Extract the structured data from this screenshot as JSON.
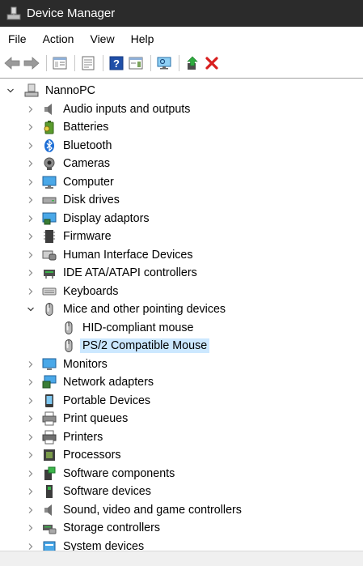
{
  "window": {
    "title": "Device Manager"
  },
  "menu": [
    "File",
    "Action",
    "View",
    "Help"
  ],
  "colors": {
    "titlebar": "#2b2b2b",
    "selection": "#cce8ff",
    "accent": "#0078d7"
  },
  "tree": {
    "root": "NannoPC",
    "categories": [
      {
        "label": "Audio inputs and outputs",
        "icon": "speaker-icon"
      },
      {
        "label": "Batteries",
        "icon": "battery-icon"
      },
      {
        "label": "Bluetooth",
        "icon": "bluetooth-icon"
      },
      {
        "label": "Cameras",
        "icon": "camera-icon"
      },
      {
        "label": "Computer",
        "icon": "computer-icon"
      },
      {
        "label": "Disk drives",
        "icon": "disk-drive-icon"
      },
      {
        "label": "Display adaptors",
        "icon": "display-adapter-icon"
      },
      {
        "label": "Firmware",
        "icon": "firmware-icon"
      },
      {
        "label": "Human Interface Devices",
        "icon": "hid-icon"
      },
      {
        "label": "IDE ATA/ATAPI controllers",
        "icon": "ide-controller-icon"
      },
      {
        "label": "Keyboards",
        "icon": "keyboard-icon"
      },
      {
        "label": "Mice and other pointing devices",
        "icon": "mouse-icon",
        "expanded": true,
        "children": [
          {
            "label": "HID-compliant mouse",
            "icon": "mouse-icon"
          },
          {
            "label": "PS/2 Compatible Mouse",
            "icon": "mouse-icon",
            "selected": true
          }
        ]
      },
      {
        "label": "Monitors",
        "icon": "monitor-icon"
      },
      {
        "label": "Network adapters",
        "icon": "network-adapter-icon"
      },
      {
        "label": "Portable Devices",
        "icon": "portable-device-icon"
      },
      {
        "label": "Print queues",
        "icon": "print-queue-icon"
      },
      {
        "label": "Printers",
        "icon": "printer-icon"
      },
      {
        "label": "Processors",
        "icon": "processor-icon"
      },
      {
        "label": "Software components",
        "icon": "software-component-icon"
      },
      {
        "label": "Software devices",
        "icon": "software-device-icon"
      },
      {
        "label": "Sound, video and game controllers",
        "icon": "sound-icon"
      },
      {
        "label": "Storage controllers",
        "icon": "storage-controller-icon"
      },
      {
        "label": "System devices",
        "icon": "system-device-icon"
      }
    ]
  }
}
